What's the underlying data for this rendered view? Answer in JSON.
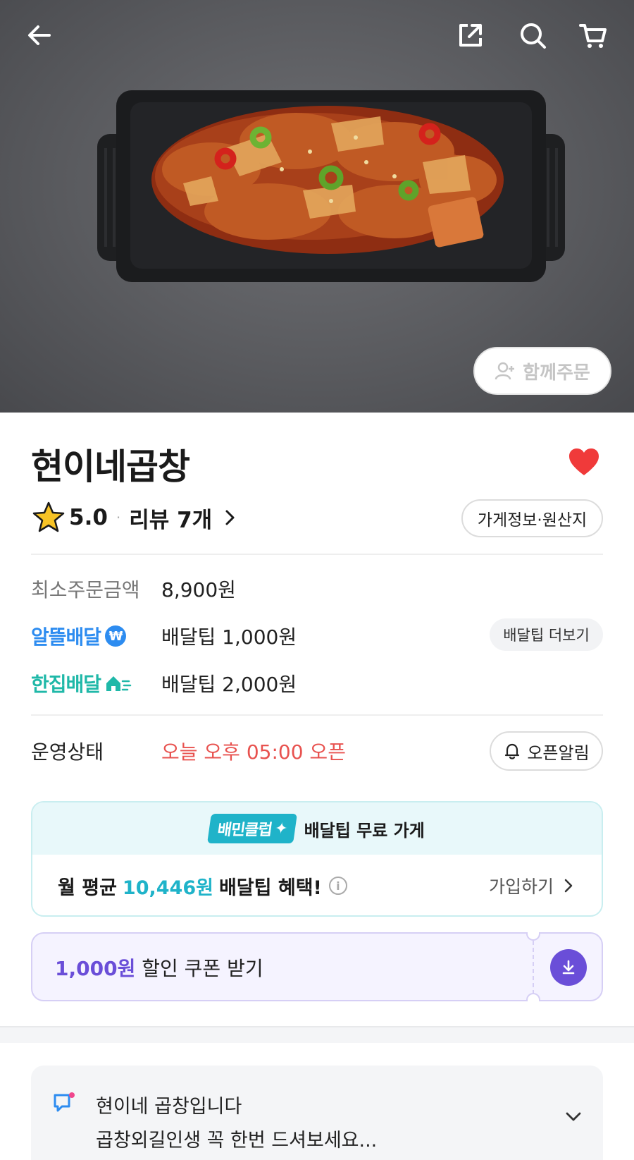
{
  "hero": {
    "together_order_label": "함께주문"
  },
  "store": {
    "name": "현이네곱창",
    "rating": "5.0",
    "review_label": "리뷰 7개",
    "info_button_label": "가게정보·원산지",
    "favorited": true
  },
  "info": {
    "min_order_label": "최소주문금액",
    "min_order_value": "8,900원",
    "saver_delivery_label": "알뜰배달",
    "saver_delivery_value": "배달팁 1,000원",
    "more_delivery_tip_label": "배달팁 더보기",
    "single_delivery_label": "한집배달",
    "single_delivery_value": "배달팁 2,000원",
    "status_label": "운영상태",
    "status_value": "오늘 오후 05:00 오픈",
    "open_alarm_label": "오픈알림"
  },
  "club": {
    "badge": "배민클럽",
    "header_text": "배달팁 무료 가게",
    "benefit_prefix": "월 평균",
    "benefit_amount": "10,446원",
    "benefit_suffix": "배달팁 혜택!",
    "join_label": "가입하기"
  },
  "coupon": {
    "amount": "1,000원",
    "text": "할인 쿠폰 받기"
  },
  "notice": {
    "line1": "현이네 곱창입니다",
    "line2": "곱창외길인생 꼭 한번 드셔보세요..."
  },
  "colors": {
    "brand_blue": "#2d8cf0",
    "brand_teal": "#1fb8a8",
    "status_red": "#e8524f",
    "coupon_purple": "#6a4ed8",
    "heart_red": "#f03a3a"
  }
}
